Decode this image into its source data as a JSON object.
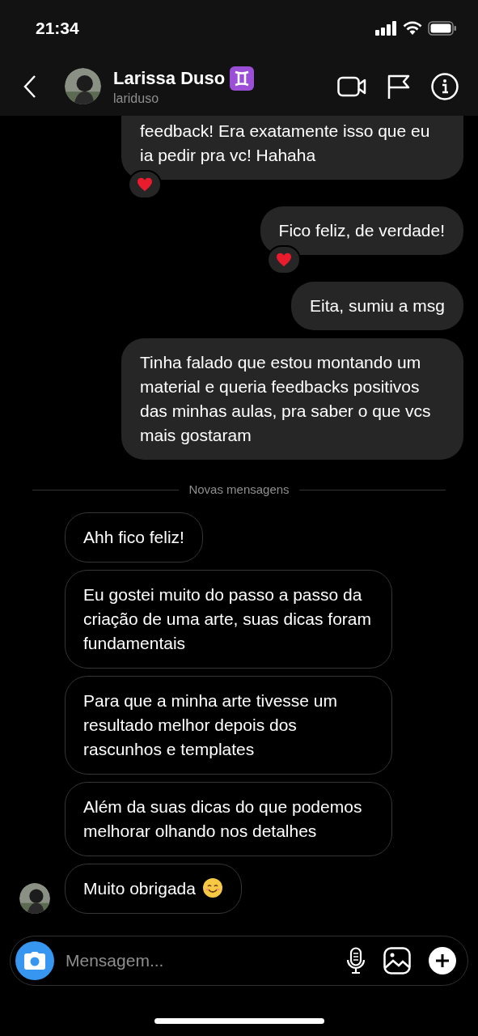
{
  "status_bar": {
    "time": "21:34"
  },
  "header": {
    "name": "Larissa Duso",
    "username": "lariduso",
    "zodiac_badge": true
  },
  "messages": [
    {
      "kind": "sent",
      "lines": "feedback! Era exatamente isso que eu ia pedir pra vc! Hahaha",
      "cut_top": true,
      "reacted": true
    },
    {
      "kind": "sent",
      "lines": "Fico feliz, de verdade!",
      "cut_top": false,
      "reacted": true
    },
    {
      "kind": "sent",
      "lines": "Eita, sumiu a msg",
      "cut_top": false,
      "reacted": false
    },
    {
      "kind": "sent",
      "lines": "Tinha falado que estou montando um material e queria feedbacks positivos das minhas aulas, pra saber o que vcs mais gostaram",
      "cut_top": false,
      "reacted": false
    },
    {
      "kind": "divider",
      "lines": "Novas mensagens"
    },
    {
      "kind": "received",
      "lines": "Ahh fico feliz!",
      "avatar": false,
      "smiley": false
    },
    {
      "kind": "received",
      "lines": "Eu gostei muito do passo a passo da criação de uma arte, suas dicas foram fundamentais",
      "avatar": false,
      "smiley": false
    },
    {
      "kind": "received",
      "lines": "Para que a minha arte tivesse um resultado melhor depois dos rascunhos e templates",
      "avatar": false,
      "smiley": false
    },
    {
      "kind": "received",
      "lines": "Além da suas dicas do que podemos melhorar olhando nos detalhes",
      "avatar": false,
      "smiley": false
    },
    {
      "kind": "received",
      "lines": "Muito obrigada",
      "avatar": true,
      "smiley": true
    }
  ],
  "composer": {
    "placeholder": "Mensagem..."
  }
}
